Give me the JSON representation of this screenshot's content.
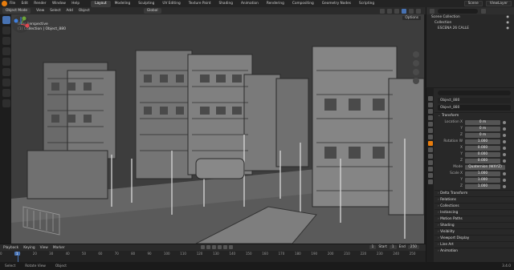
{
  "menu": {
    "items": [
      "File",
      "Edit",
      "Render",
      "Window",
      "Help"
    ]
  },
  "workspaces": [
    "Layout",
    "Modeling",
    "Sculpting",
    "UV Editing",
    "Texture Paint",
    "Shading",
    "Animation",
    "Rendering",
    "Compositing",
    "Geometry Nodes",
    "Scripting"
  ],
  "active_workspace": "Layout",
  "topright": {
    "scene": "Scene",
    "view_layer": "ViewLayer"
  },
  "header": {
    "mode": "Object Mode",
    "view": "View",
    "select": "Select",
    "add": "Add",
    "object": "Object",
    "orientation": "Global",
    "options": "Options"
  },
  "viewport": {
    "perspective": "User Perspective",
    "collection": "(1) Collection | Object_880"
  },
  "outliner": {
    "title": "Scene Collection",
    "rows": [
      {
        "label": "Scene Collection",
        "selected": false
      },
      {
        "label": "Collection",
        "selected": false
      },
      {
        "label": "ESCENA 26 CALLE",
        "selected": false
      }
    ]
  },
  "properties": {
    "object_name": "Object_880",
    "object_field": "Object_880",
    "sections": {
      "transform": "Transform",
      "delta": "Delta Transform",
      "relations": "Relations",
      "collections": "Collections",
      "instancing": "Instancing",
      "motion": "Motion Paths",
      "shading": "Shading",
      "visibility": "Visibility",
      "viewport_display": "Viewport Display",
      "line_art": "Line Art",
      "animation": "Animation"
    },
    "location": {
      "label": "Location X",
      "x": "0 m",
      "y": "0 m",
      "z": "0 m"
    },
    "rotation": {
      "label": "Rotation W",
      "w": "1.000",
      "x": "0.000",
      "y": "0.000",
      "z": "0.000"
    },
    "mode": {
      "label": "Mode",
      "value": "Quaternion (WXYZ)"
    },
    "scale": {
      "label": "Scale X",
      "x": "1.000",
      "y": "1.000",
      "z": "1.000"
    },
    "axis_labels": {
      "x": "X",
      "y": "Y",
      "z": "Z",
      "w": "W"
    }
  },
  "timeline": {
    "playback": "Playback",
    "keying": "Keying",
    "view": "View",
    "marker": "Marker",
    "current_frame": "1",
    "start_label": "Start",
    "start": "1",
    "end_label": "End",
    "end": "250",
    "ruler": [
      "0",
      "10",
      "20",
      "30",
      "40",
      "50",
      "60",
      "70",
      "80",
      "90",
      "100",
      "110",
      "120",
      "130",
      "140",
      "150",
      "160",
      "170",
      "180",
      "190",
      "200",
      "210",
      "220",
      "230",
      "240",
      "250"
    ]
  },
  "status": {
    "select": "Select",
    "rotate": "Rotate View",
    "object": "Object",
    "version": "3.4.0"
  }
}
